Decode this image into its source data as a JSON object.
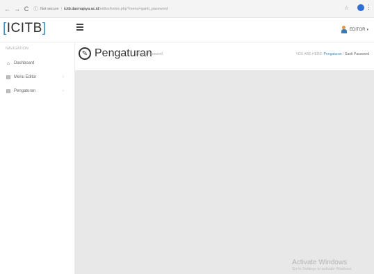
{
  "browser": {
    "back": "←",
    "forward": "→",
    "reload": "C",
    "security": "Not secure",
    "url_domain": "icitb.darmajaya.ac.id",
    "url_path": "/editor/index.php?menu=ganti_password"
  },
  "header": {
    "logo_bracket_left": "[",
    "logo_text": "ICITB",
    "logo_bracket_right": "]",
    "user_label": "EDITOR"
  },
  "sidebar": {
    "heading": "NAVIGATION",
    "items": [
      {
        "label": "Dashboard",
        "icon": "dashboard-icon",
        "has_submenu": false
      },
      {
        "label": "Menu Editor",
        "icon": "document-icon",
        "has_submenu": true
      },
      {
        "label": "Pengaturan",
        "icon": "document-icon",
        "has_submenu": true
      }
    ]
  },
  "page": {
    "title": "Pengaturan",
    "subtitle": "/ Ganti Password",
    "breadcrumb": {
      "prefix": "YOU ARE HERE:",
      "link": "Pengaturan",
      "separator": "/",
      "current": "Ganti Password"
    }
  },
  "watermark": {
    "line1": "Activate Windows",
    "line2": "Go to Settings to activate Windows."
  },
  "colors": {
    "accent": "#3c8dbc",
    "content_bg": "#e8e8e8"
  }
}
